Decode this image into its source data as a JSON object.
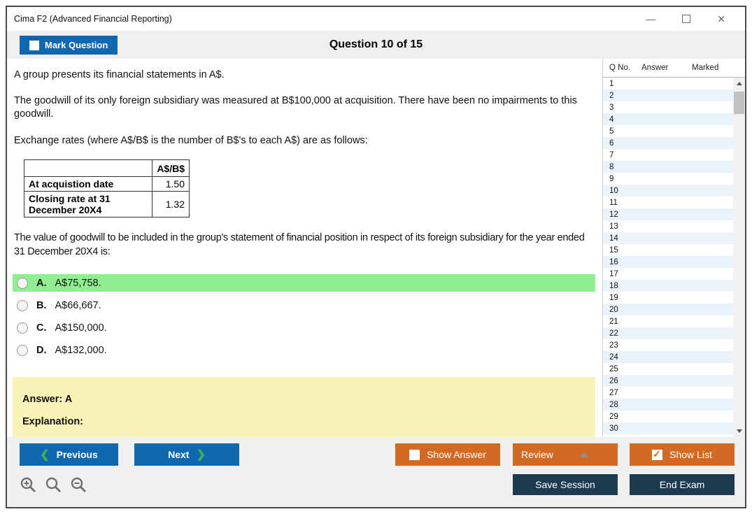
{
  "window": {
    "title": "Cima F2 (Advanced Financial Reporting)",
    "controls": {
      "minimize_glyph": "—",
      "close_glyph": "✕"
    }
  },
  "header": {
    "mark_question_label": "Mark Question",
    "question_counter": "Question 10 of 15"
  },
  "question": {
    "paragraphs": [
      "A group presents its financial statements in A$.",
      "The goodwill of its only foreign subsidiary was measured at B$100,000 at acquisition. There have been no impairments to this goodwill.",
      "Exchange rates (where A$/B$ is the number of B$'s to each A$) are as follows:"
    ],
    "table": {
      "header": [
        "",
        "A$/B$"
      ],
      "rows": [
        {
          "label": "At acquistion date",
          "value": "1.50"
        },
        {
          "label": "Closing rate at 31 December 20X4",
          "value": "1.32"
        }
      ]
    },
    "stem": "The value of goodwill to be included in the group's statement of financial position in respect of its foreign subsidiary for the year ended 31 December 20X4 is:",
    "options": [
      {
        "letter": "A.",
        "text": "A$75,758.",
        "highlighted": true
      },
      {
        "letter": "B.",
        "text": "A$66,667.",
        "highlighted": false
      },
      {
        "letter": "C.",
        "text": "A$150,000.",
        "highlighted": false
      },
      {
        "letter": "D.",
        "text": "A$132,000.",
        "highlighted": false
      }
    ],
    "answer_panel": {
      "answer_label": "Answer: A",
      "explanation_label": "Explanation:"
    }
  },
  "sidebar": {
    "columns": {
      "q_no": "Q No.",
      "answer": "Answer",
      "marked": "Marked"
    },
    "row_numbers": [
      "1",
      "2",
      "3",
      "4",
      "5",
      "6",
      "7",
      "8",
      "9",
      "10",
      "11",
      "12",
      "13",
      "14",
      "15",
      "16",
      "17",
      "18",
      "19",
      "20",
      "21",
      "22",
      "23",
      "24",
      "25",
      "26",
      "27",
      "28",
      "29",
      "30"
    ]
  },
  "footer": {
    "previous_label": "Previous",
    "next_label": "Next",
    "show_answer_label": "Show Answer",
    "review_label": "Review",
    "show_list_label": "Show List",
    "save_session_label": "Save Session",
    "end_exam_label": "End Exam",
    "prev_chevron": "❮",
    "next_chevron": "❯"
  },
  "colors": {
    "blue": "#1168b0",
    "orange": "#d26a24",
    "navy": "#1c3a50",
    "green": "#3db54a",
    "highlight": "#90ee90",
    "yellow": "#faf3b8",
    "altrow": "#eaf3fa"
  }
}
